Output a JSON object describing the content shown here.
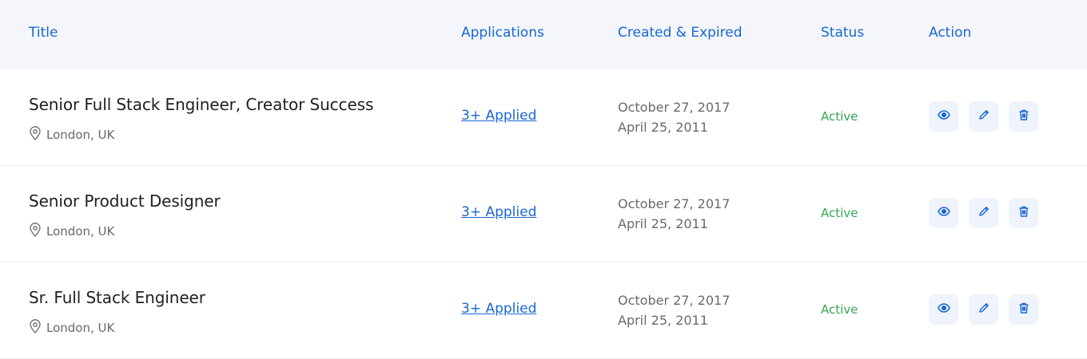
{
  "header": {
    "title": "Title",
    "applications": "Applications",
    "created_expired": "Created & Expired",
    "status": "Status",
    "action": "Action"
  },
  "rows": [
    {
      "title": "Senior Full Stack Engineer, Creator Success",
      "location": "London, UK",
      "applied": "3+ Applied",
      "created": "October 27, 2017",
      "expired": "April 25, 2011",
      "status": "Active"
    },
    {
      "title": "Senior Product Designer",
      "location": "London, UK",
      "applied": "3+ Applied",
      "created": "October 27, 2017",
      "expired": "April 25, 2011",
      "status": "Active"
    },
    {
      "title": "Sr. Full Stack Engineer",
      "location": "London, UK",
      "applied": "3+ Applied",
      "created": "October 27, 2017",
      "expired": "April 25, 2011",
      "status": "Active"
    }
  ],
  "colors": {
    "accent": "#1967d2",
    "status_active": "#34a853",
    "header_bg": "#f4f6fb",
    "action_bg": "#eef3fc"
  },
  "icons": {
    "location": "map-pin-icon",
    "view": "eye-icon",
    "edit": "pencil-icon",
    "delete": "trash-icon"
  }
}
